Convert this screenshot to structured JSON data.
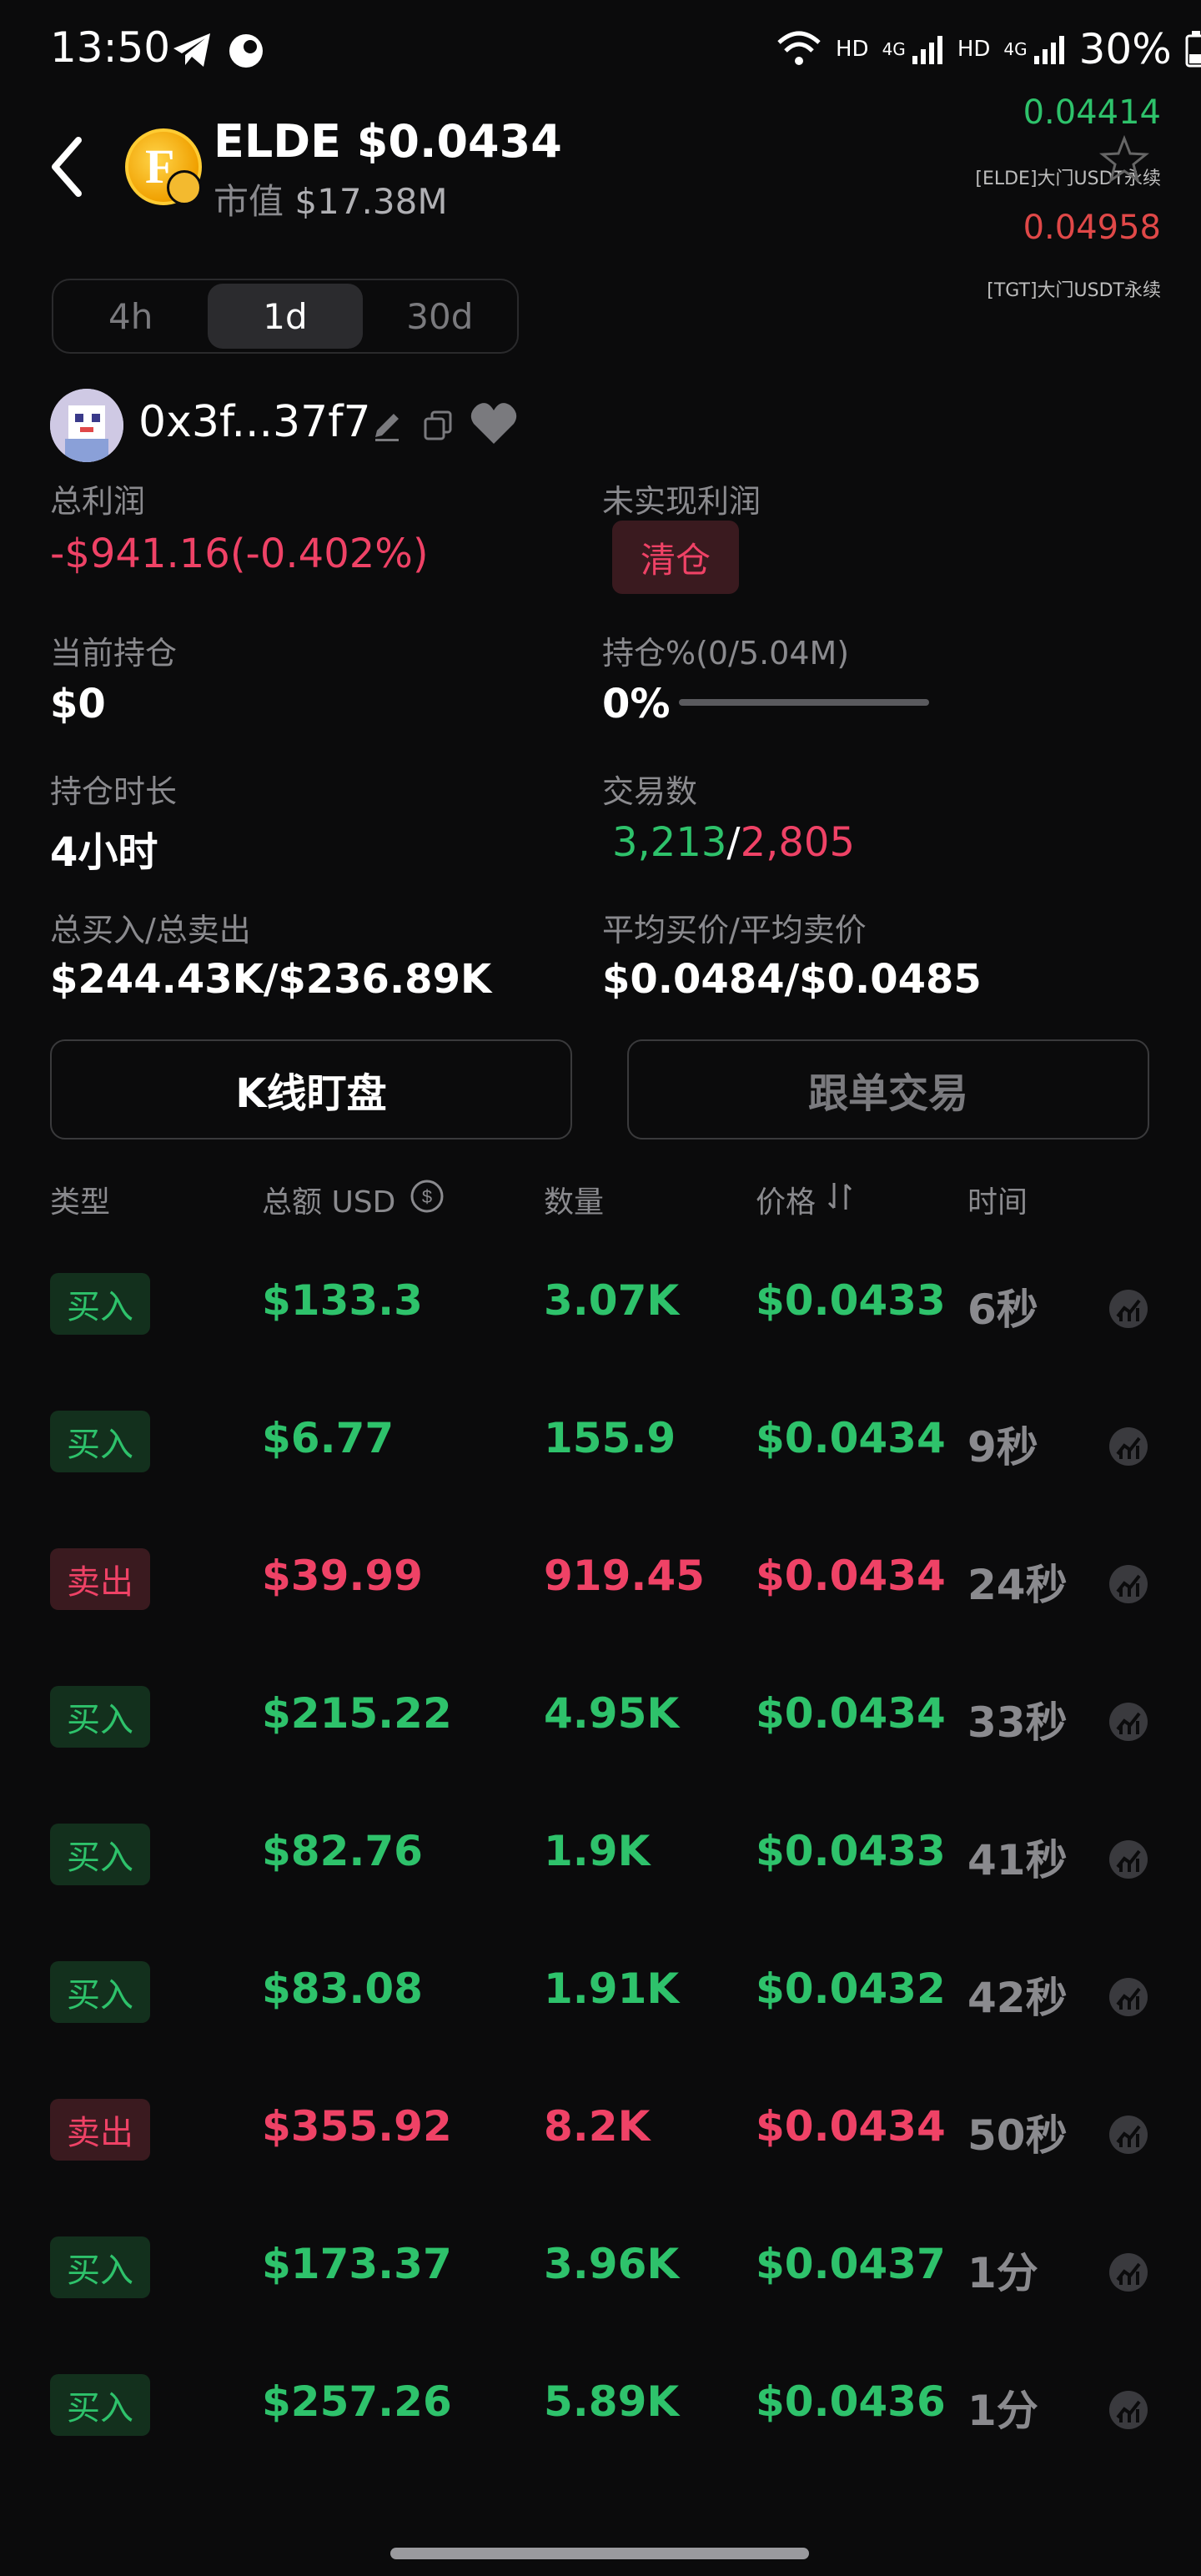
{
  "status_bar": {
    "time": "13:50",
    "hd1": "HD",
    "net1": "4G",
    "hd2": "HD",
    "net2": "4G",
    "battery": "30%"
  },
  "token": {
    "title": "ELDE $0.0434",
    "mcap_label": "市值",
    "mcap_value": "$17.38M",
    "logo_letter": "F"
  },
  "floating_prices": [
    {
      "price": "0.04414",
      "label": "[ELDE]大门USDT永续",
      "color": "#2ec26b"
    },
    {
      "price": "0.04958",
      "label": "[TGT]大门USDT永续",
      "color": "#e04848"
    }
  ],
  "tabs": [
    {
      "label": "4h",
      "active": false
    },
    {
      "label": "1d",
      "active": true
    },
    {
      "label": "30d",
      "active": false
    }
  ],
  "wallet": {
    "address": "0x3f...37f7"
  },
  "stats": {
    "total_profit_label": "总利润",
    "total_profit_value": "-$941.16(-0.402%)",
    "unrealized_label": "未实现利润",
    "clear_button": "清仓",
    "holding_label": "当前持仓",
    "holding_value": "$0",
    "holding_pct_label": "持仓%(0/5.04M)",
    "holding_pct_value": "0%",
    "holding_pct_fill": 0,
    "duration_label": "持仓时长",
    "duration_value": "4小时",
    "trades_label": "交易数",
    "trades_buy": "3,213",
    "trades_sep": "/",
    "trades_sell": "2,805",
    "buysell_label": "总买入/总卖出",
    "buysell_value": "$244.43K/$236.89K",
    "avg_label": "平均买价/平均卖价",
    "avg_value": "$0.0484/$0.0485"
  },
  "actions": {
    "kline": "K线盯盘",
    "follow": "跟单交易"
  },
  "table": {
    "headers": {
      "type": "类型",
      "amount": "总额 USD",
      "qty": "数量",
      "price": "价格",
      "time": "时间"
    },
    "rows": [
      {
        "type": "买入",
        "side": "buy",
        "amount": "$133.3",
        "qty": "3.07K",
        "price": "$0.0433",
        "time": "6秒"
      },
      {
        "type": "买入",
        "side": "buy",
        "amount": "$6.77",
        "qty": "155.9",
        "price": "$0.0434",
        "time": "9秒"
      },
      {
        "type": "卖出",
        "side": "sell",
        "amount": "$39.99",
        "qty": "919.45",
        "price": "$0.0434",
        "time": "24秒"
      },
      {
        "type": "买入",
        "side": "buy",
        "amount": "$215.22",
        "qty": "4.95K",
        "price": "$0.0434",
        "time": "33秒"
      },
      {
        "type": "买入",
        "side": "buy",
        "amount": "$82.76",
        "qty": "1.9K",
        "price": "$0.0433",
        "time": "41秒"
      },
      {
        "type": "买入",
        "side": "buy",
        "amount": "$83.08",
        "qty": "1.91K",
        "price": "$0.0432",
        "time": "42秒"
      },
      {
        "type": "卖出",
        "side": "sell",
        "amount": "$355.92",
        "qty": "8.2K",
        "price": "$0.0434",
        "time": "50秒"
      },
      {
        "type": "买入",
        "side": "buy",
        "amount": "$173.37",
        "qty": "3.96K",
        "price": "$0.0437",
        "time": "1分"
      },
      {
        "type": "买入",
        "side": "buy",
        "amount": "$257.26",
        "qty": "5.89K",
        "price": "$0.0436",
        "time": "1分"
      }
    ]
  },
  "icons": {
    "back": "back-arrow-icon",
    "star": "star-icon",
    "edit": "edit-icon",
    "copy": "copy-icon",
    "heart": "heart-icon",
    "currency_switch": "currency-switch-icon",
    "sort": "sort-icon",
    "row_chart": "chart-icon"
  }
}
